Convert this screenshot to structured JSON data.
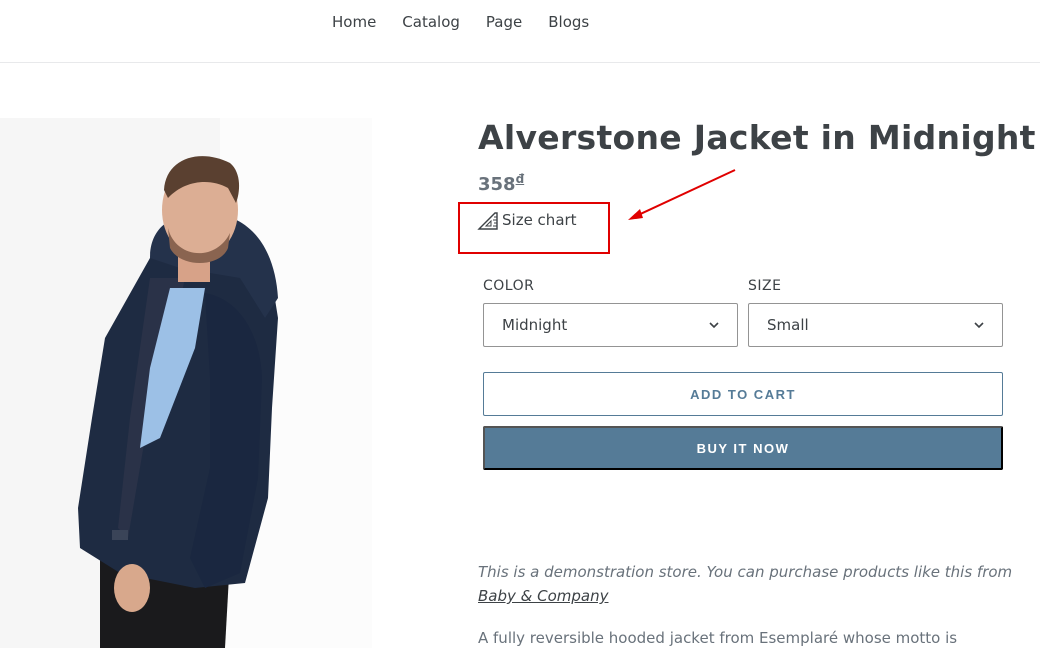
{
  "nav": {
    "items": [
      {
        "label": "Home"
      },
      {
        "label": "Catalog"
      },
      {
        "label": "Page"
      },
      {
        "label": "Blogs"
      }
    ]
  },
  "product": {
    "title": "Alverstone Jacket in Midnight",
    "price": "358",
    "currency": "đ",
    "size_chart_label": "Size chart",
    "options": {
      "color_label": "COLOR",
      "color_value": "Midnight",
      "size_label": "SIZE",
      "size_value": "Small"
    },
    "add_to_cart_label": "ADD TO CART",
    "buy_now_label": "BUY IT NOW",
    "description_demo_text": "This is a demonstration store. You can purchase products like this from",
    "description_demo_link": "Baby & Company",
    "description_text": "A fully reversible hooded jacket from Esemplaré whose motto is"
  },
  "colors": {
    "accent": "#557b97",
    "highlight": "#e00000",
    "text": "#3d4246"
  },
  "icons": {
    "size_chart": "ruler-icon",
    "select_chevron": "chevron-down-icon",
    "annotation": "arrow-annotation"
  }
}
